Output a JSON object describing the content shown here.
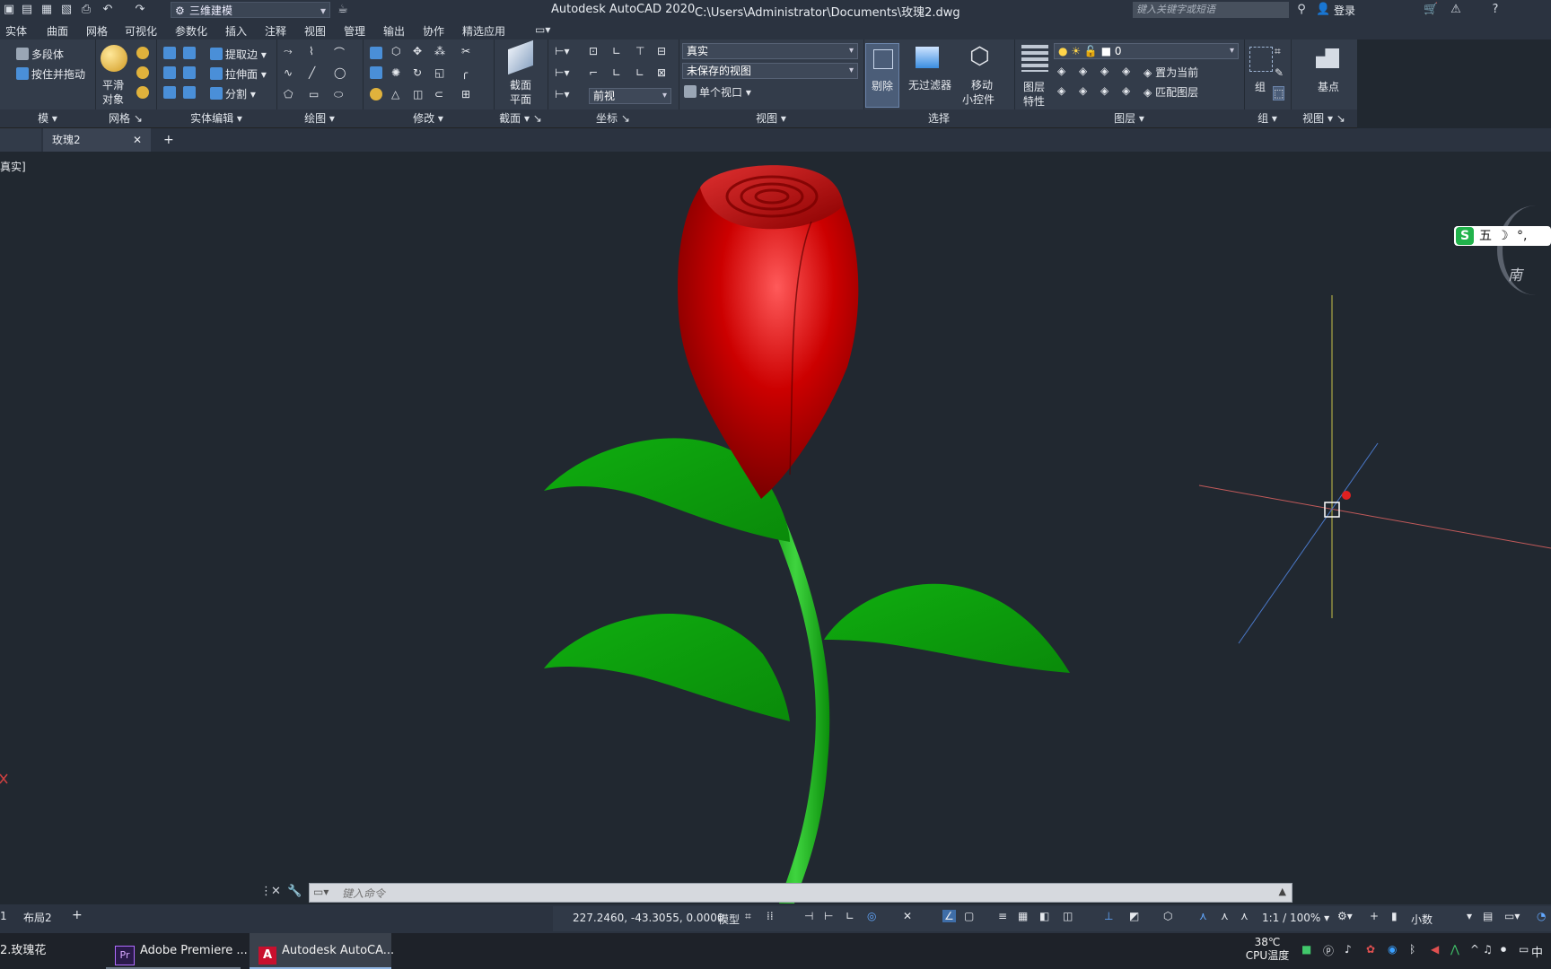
{
  "titlebar": {
    "workspace": "三维建模",
    "title": "Autodesk AutoCAD 2020",
    "path": "C:\\Users\\Administrator\\Documents\\玫瑰2.dwg",
    "search_placeholder": "键入关键字或短语",
    "login": "登录"
  },
  "menu": [
    "实体",
    "曲面",
    "网格",
    "可视化",
    "参数化",
    "插入",
    "注释",
    "视图",
    "管理",
    "输出",
    "协作",
    "精选应用"
  ],
  "ribbon": {
    "modeling": {
      "polysolid": "多段体",
      "presspull": "按住并拖动",
      "label": "模"
    },
    "mesh": {
      "smooth1": "平滑",
      "smooth2": "对象",
      "label": "网格"
    },
    "solid_edit": {
      "extract": "提取边",
      "extrude": "拉伸面",
      "split": "分割",
      "label": "实体编辑"
    },
    "draw": {
      "label": "绘图"
    },
    "modify": {
      "label": "修改"
    },
    "section": {
      "plane1": "截面",
      "plane2": "平面",
      "label": "截面"
    },
    "coords": {
      "view_select": "前视",
      "label": "坐标"
    },
    "view": {
      "visual_style": "真实",
      "saved_view": "未保存的视图",
      "viewport": "单个视口",
      "label": "视图"
    },
    "selection": {
      "cull": "剔除",
      "nofilter": "无过滤器",
      "gizmo1": "移动",
      "gizmo2": "小控件",
      "label": "选择"
    },
    "layers": {
      "layer_value": "0",
      "props1": "图层",
      "props2": "特性",
      "set_current": "置为当前",
      "match": "匹配图层",
      "label": "图层"
    },
    "groups": {
      "group": "组",
      "label": "组"
    },
    "view2": {
      "basepoint": "基点",
      "label": "视图"
    }
  },
  "tabs": {
    "doc": "玫瑰2"
  },
  "viewport": {
    "label": "真实]",
    "viewcube_face": "南"
  },
  "ime": {
    "text": "五"
  },
  "command": {
    "placeholder": "键入命令"
  },
  "status": {
    "layouts": [
      "1",
      "布局2"
    ],
    "coords": "227.2460, -43.3055, 0.0000",
    "model": "模型",
    "scale": "1:1 / 100%",
    "units": "小数"
  },
  "taskbar": {
    "item1": "2.玫瑰花",
    "item2": "Adobe Premiere ...",
    "item3": "Autodesk AutoCA...",
    "temp": "38℃",
    "temp_label": "CPU温度",
    "lang": "中"
  },
  "colors": {
    "petal": "#c00000",
    "leaf": "#12a012",
    "background": "#212830"
  }
}
